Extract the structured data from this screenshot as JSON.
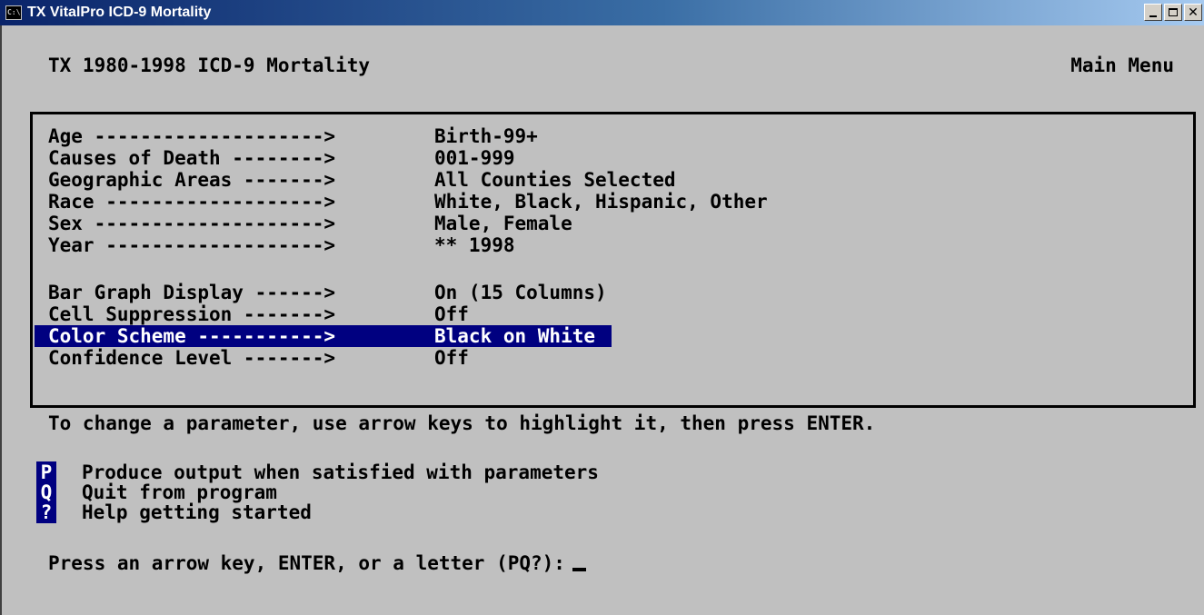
{
  "window": {
    "title": "TX VitalPro ICD-9 Mortality",
    "icon": "console-icon",
    "controls": [
      "minimize",
      "maximize",
      "close"
    ]
  },
  "header": {
    "title": "TX 1980-1998 ICD-9 Mortality",
    "menu": "Main Menu"
  },
  "parameters": [
    {
      "label": "Age --------------------> ",
      "value": "Birth-99+"
    },
    {
      "label": "Causes of Death --------> ",
      "value": "001-999"
    },
    {
      "label": "Geographic Areas -------> ",
      "value": "All Counties Selected"
    },
    {
      "label": "Race -------------------> ",
      "value": "White, Black, Hispanic, Other"
    },
    {
      "label": "Sex --------------------> ",
      "value": "Male, Female"
    },
    {
      "label": "Year -------------------> ",
      "value": "** 1998"
    }
  ],
  "settings": [
    {
      "label": "Bar Graph Display ------> ",
      "value": "On (15 Columns)"
    },
    {
      "label": "Cell Suppression -------> ",
      "value": "Off"
    },
    {
      "label": "Color Scheme -----------> ",
      "value": "Black on White",
      "selected": true
    },
    {
      "label": "Confidence Level -------> ",
      "value": "Off"
    }
  ],
  "instruction": "To change a parameter, use arrow keys to highlight it, then press ENTER.",
  "options": [
    {
      "key": "P",
      "desc": "Produce output when satisfied with parameters"
    },
    {
      "key": "Q",
      "desc": "Quit from program"
    },
    {
      "key": "?",
      "desc": "Help getting started"
    }
  ],
  "prompt": "Press an arrow key, ENTER, or a letter (PQ?):",
  "colors": {
    "highlight": "#000080",
    "background": "#c0c0c0",
    "text": "#000000"
  }
}
